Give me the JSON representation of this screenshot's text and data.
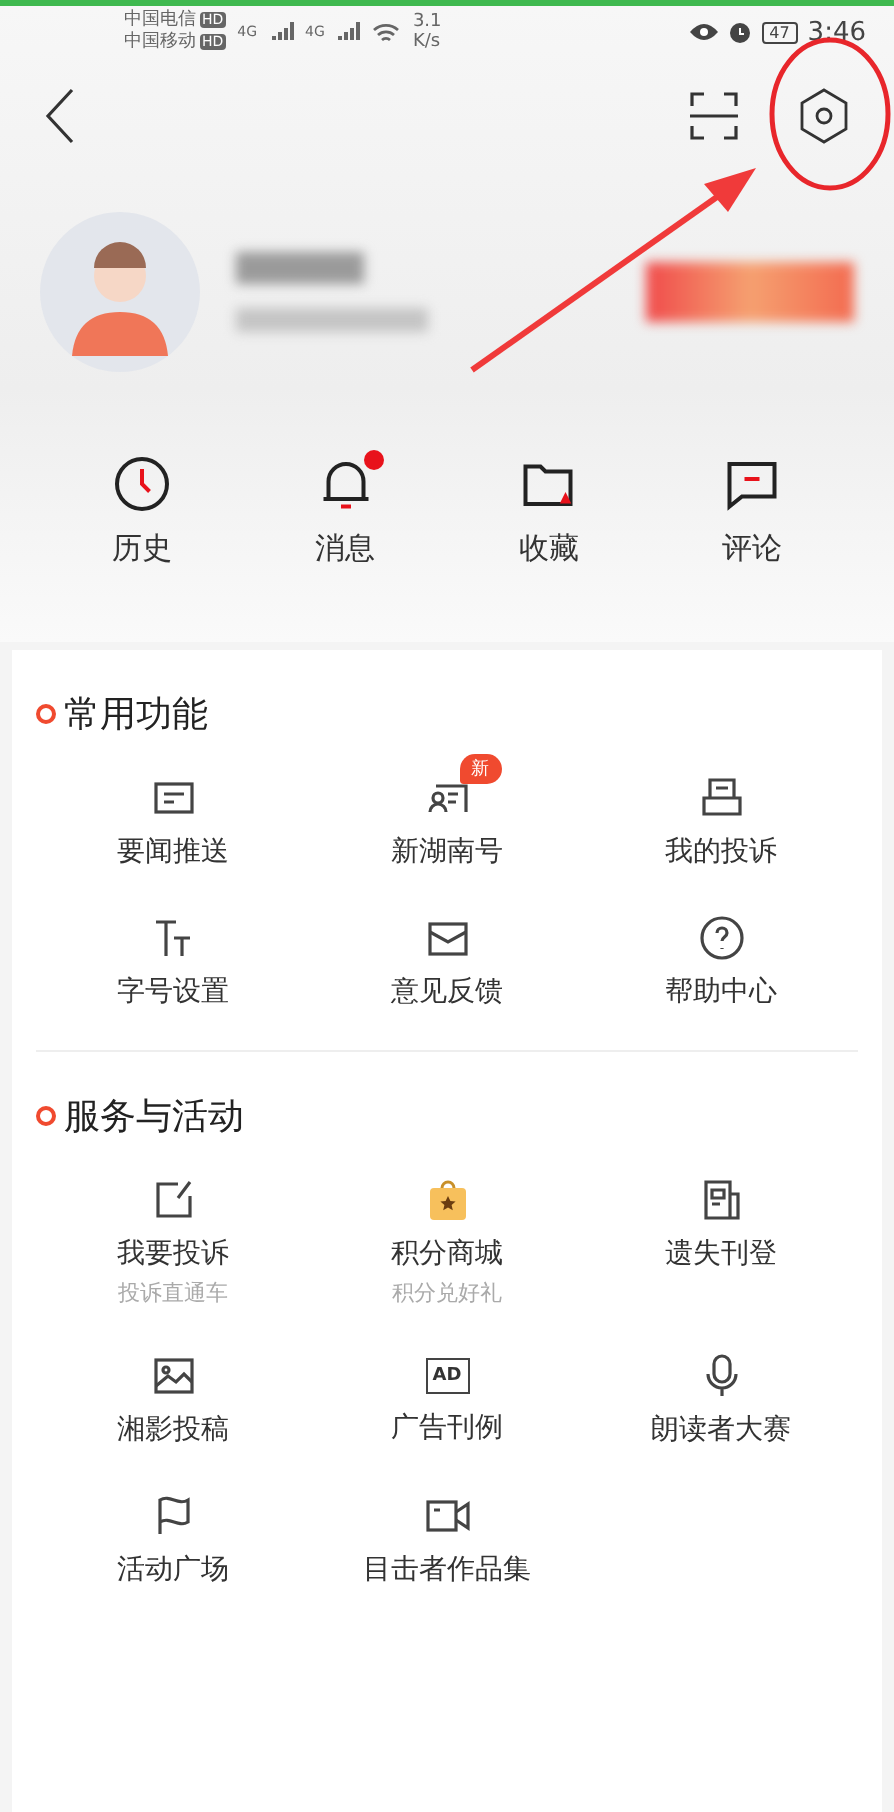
{
  "status_bar": {
    "carriers": [
      {
        "name": "中国电信",
        "tag": "HD"
      },
      {
        "name": "中国移动",
        "tag": "HD"
      }
    ],
    "signals": [
      "4G",
      "4G"
    ],
    "speed_value": "3.1",
    "speed_unit": "K/s",
    "battery": "47",
    "time": "3:46"
  },
  "quick_actions": [
    {
      "label": "历史",
      "unread": false
    },
    {
      "label": "消息",
      "unread": true
    },
    {
      "label": "收藏",
      "unread": false
    },
    {
      "label": "评论",
      "unread": false
    }
  ],
  "sections": [
    {
      "title": "常用功能",
      "items": [
        {
          "label": "要闻推送"
        },
        {
          "label": "新湖南号",
          "badge": "新"
        },
        {
          "label": "我的投诉"
        },
        {
          "label": "字号设置"
        },
        {
          "label": "意见反馈"
        },
        {
          "label": "帮助中心"
        }
      ]
    },
    {
      "title": "服务与活动",
      "items": [
        {
          "label": "我要投诉",
          "subtitle": "投诉直通车"
        },
        {
          "label": "积分商城",
          "subtitle": "积分兑好礼"
        },
        {
          "label": "遗失刊登"
        },
        {
          "label": "湘影投稿"
        },
        {
          "label": "广告刊例",
          "icon_text": "AD"
        },
        {
          "label": "朗读者大赛"
        },
        {
          "label": "活动广场"
        },
        {
          "label": "目击者作品集"
        }
      ]
    }
  ],
  "annotation": {
    "highlight": true
  }
}
